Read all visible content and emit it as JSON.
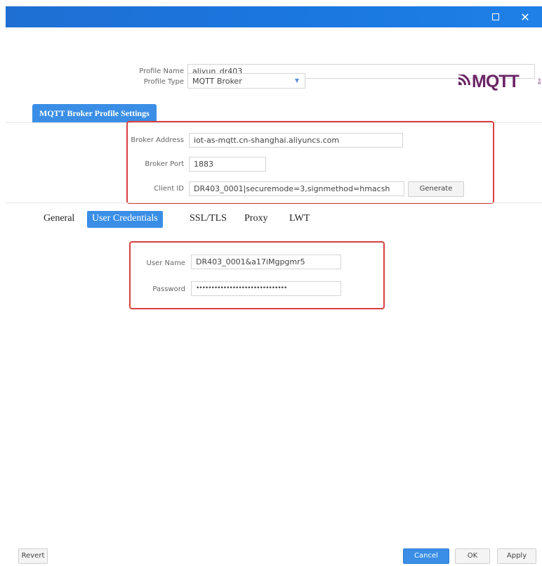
{
  "window": {
    "maximize_icon": "maximize-icon",
    "close_glyph": "✕"
  },
  "profile": {
    "name_label": "Profile Name",
    "name_value": "aliyun_dr403",
    "type_label": "Profile Type",
    "type_value": "MQTT Broker"
  },
  "logo": {
    "text": "MQTT",
    "org": ".org"
  },
  "broker_section": {
    "tab_label": "MQTT Broker Profile Settings",
    "address_label": "Broker Address",
    "address_value": "iot-as-mqtt.cn-shanghai.aliyuncs.com",
    "port_label": "Broker Port",
    "port_value": "1883",
    "client_id_label": "Client ID",
    "client_id_value": "DR403_0001|securemode=3,signmethod=hmacsh",
    "generate_label": "Generate"
  },
  "tabs": [
    {
      "label": "General",
      "active": false
    },
    {
      "label": "User Credentials",
      "active": true
    },
    {
      "label": "SSL/TLS",
      "active": false
    },
    {
      "label": "Proxy",
      "active": false
    },
    {
      "label": "LWT",
      "active": false
    }
  ],
  "credentials": {
    "username_label": "User Name",
    "username_value": "DR403_0001&a17iMgpgmr5",
    "password_label": "Password",
    "password_value": "••••••••••••••••••••••••••••••"
  },
  "footer": {
    "revert_label": "Revert",
    "cancel_label": "Cancel",
    "ok_label": "OK",
    "apply_label": "Apply"
  },
  "colors": {
    "titlebar": "#1f78e0",
    "accent": "#3a8ee6",
    "highlight_box": "#d94040",
    "mqtt_logo": "#6b2466"
  }
}
